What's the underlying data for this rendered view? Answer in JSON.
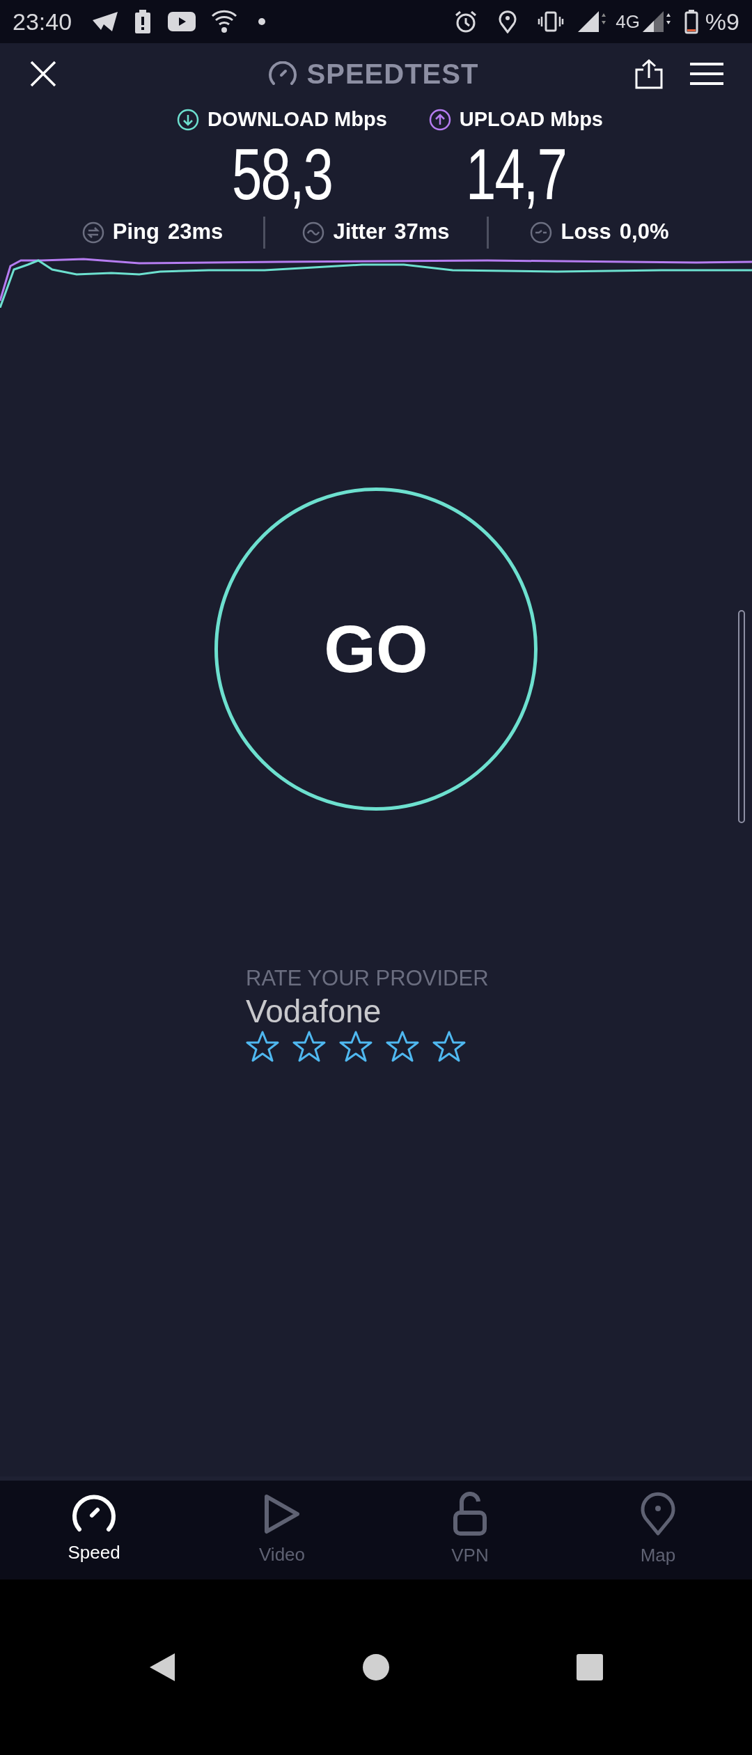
{
  "status_bar": {
    "time": "23:40",
    "network": "4G",
    "battery": "%9"
  },
  "header": {
    "title": "SPEEDTEST"
  },
  "results": [
    {
      "kind": "download",
      "label": "DOWNLOAD Mbps",
      "value": "58,3"
    },
    {
      "kind": "upload",
      "label": "UPLOAD Mbps",
      "value": "14,7"
    }
  ],
  "metrics": [
    {
      "kind": "ping",
      "label": "Ping",
      "value": "23ms"
    },
    {
      "kind": "jitter",
      "label": "Jitter",
      "value": "37ms"
    },
    {
      "kind": "loss",
      "label": "Loss",
      "value": "0,0%"
    }
  ],
  "go_button": {
    "label": "GO"
  },
  "rating": {
    "prompt": "RATE YOUR PROVIDER",
    "provider": "Vodafone",
    "stars": 0
  },
  "tabs": [
    {
      "kind": "speed",
      "label": "Speed",
      "selected": true
    },
    {
      "kind": "video",
      "label": "Video",
      "selected": false
    },
    {
      "kind": "vpn",
      "label": "VPN",
      "selected": false
    },
    {
      "kind": "map",
      "label": "Map",
      "selected": false
    }
  ]
}
